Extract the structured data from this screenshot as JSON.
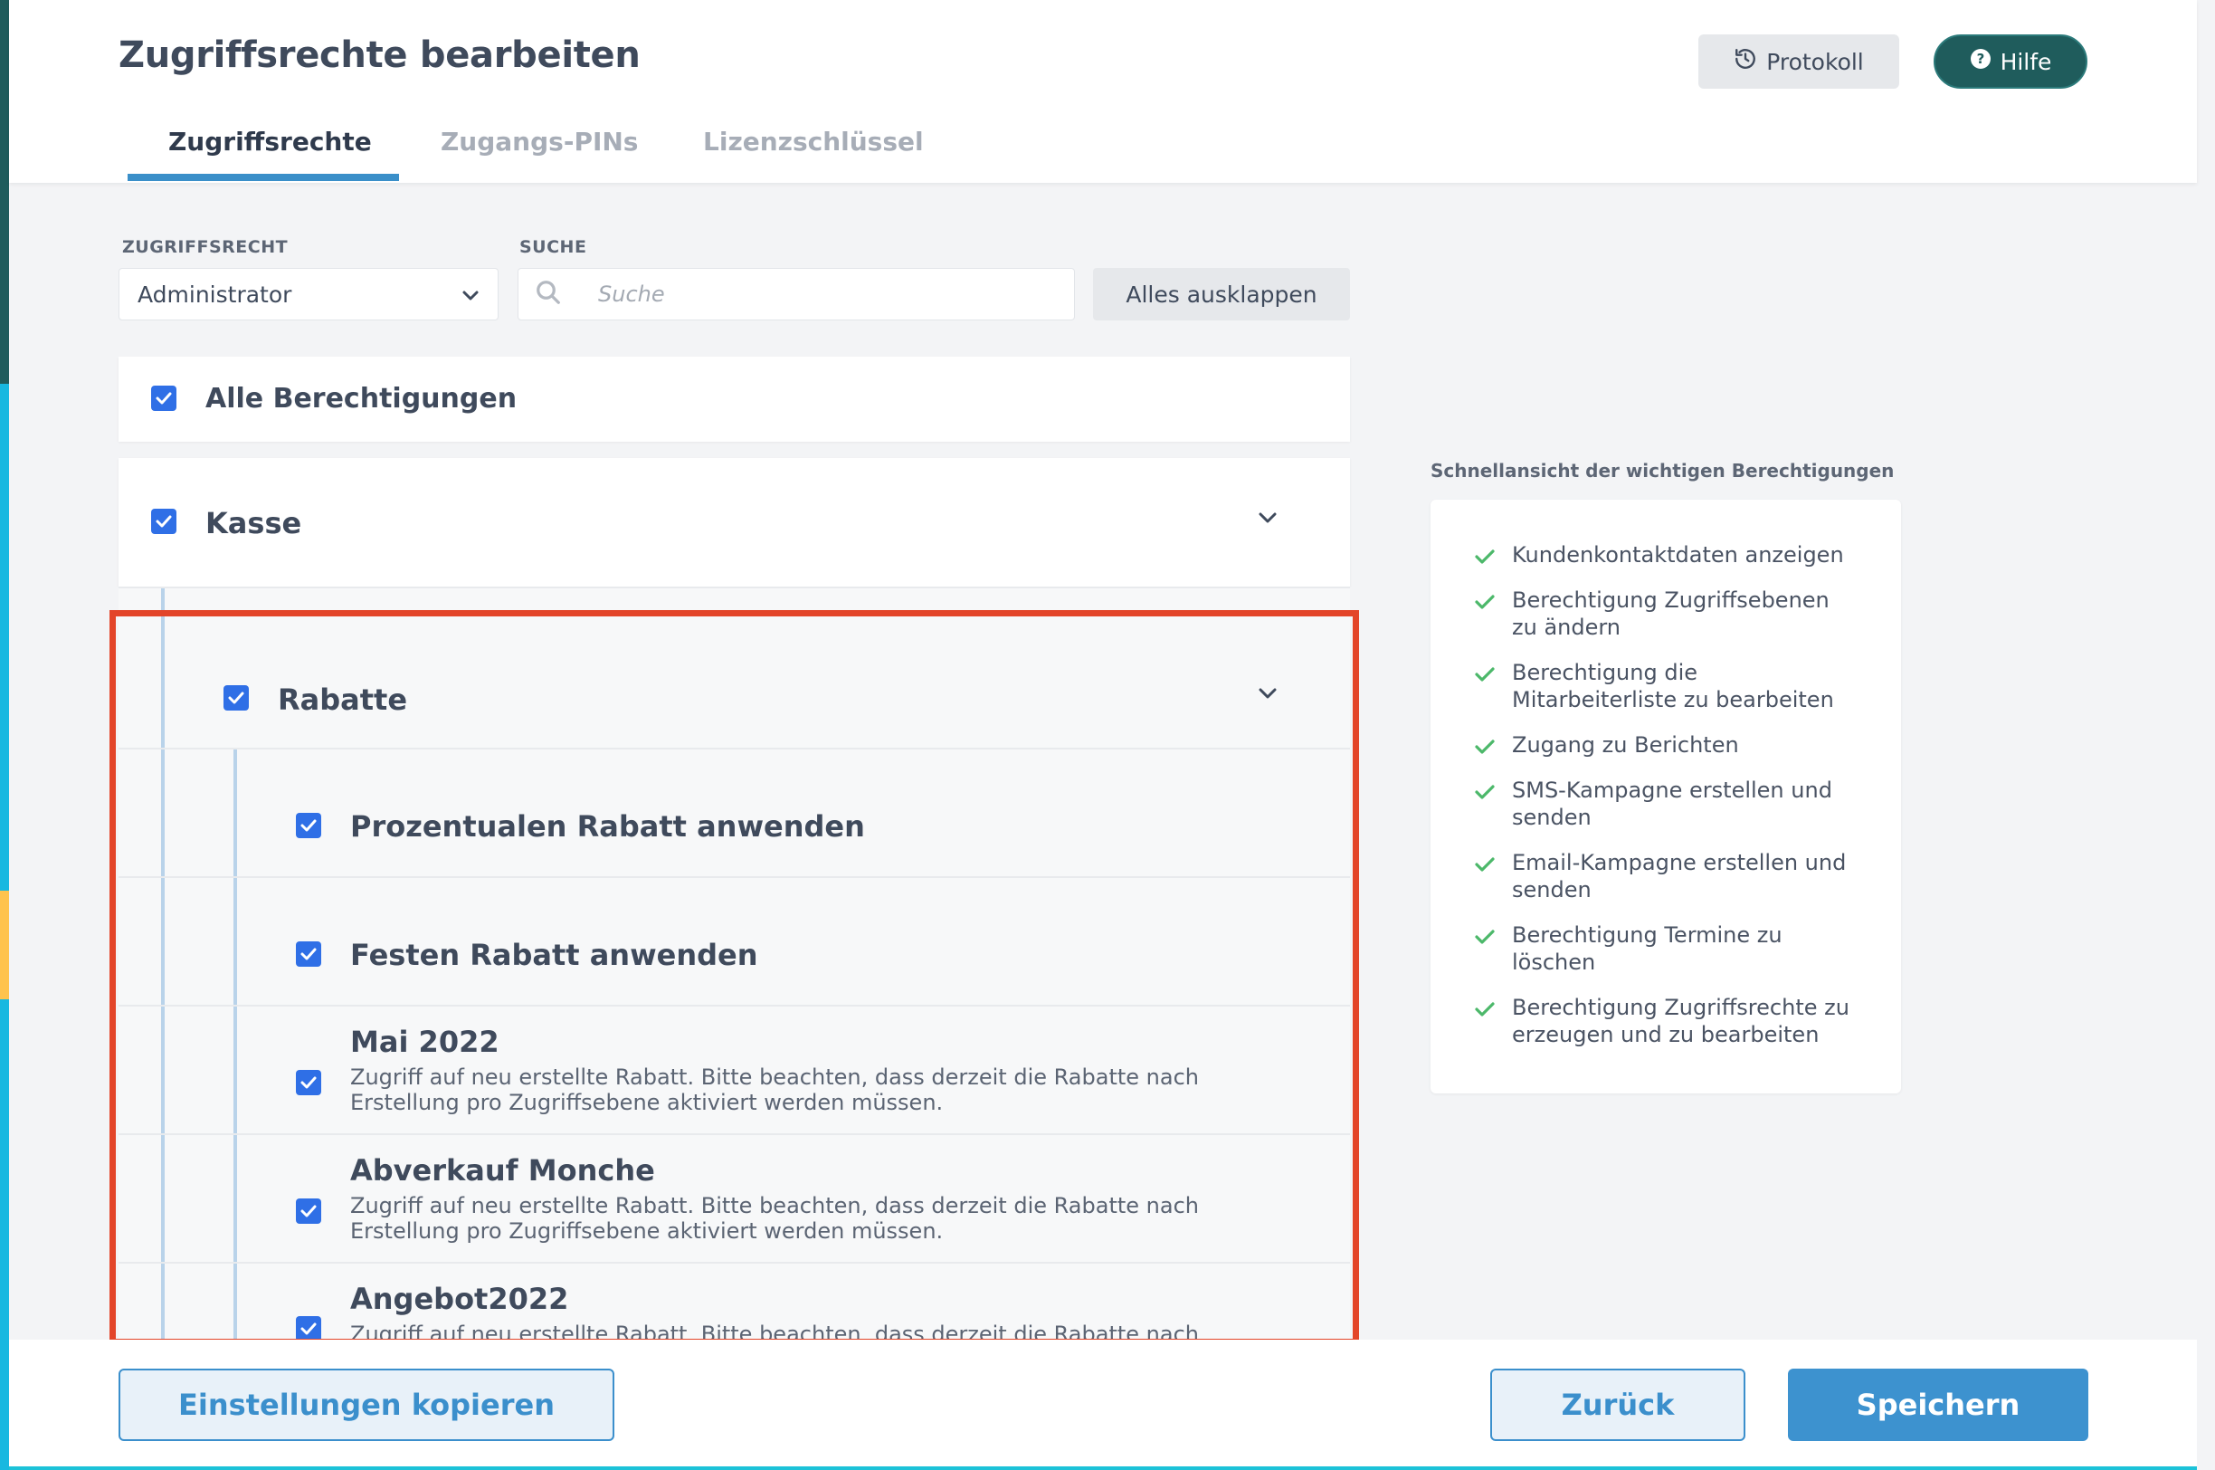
{
  "page": {
    "title": "Zugriffsrechte bearbeiten"
  },
  "header": {
    "protokoll_label": "Protokoll",
    "hilfe_label": "Hilfe",
    "tabs": [
      {
        "label": "Zugriffsrechte",
        "active": true
      },
      {
        "label": "Zugangs-PINs",
        "active": false
      },
      {
        "label": "Lizenzschlüssel",
        "active": false
      }
    ]
  },
  "filters": {
    "role_label": "ZUGRIFFSRECHT",
    "role_value": "Administrator",
    "search_label": "SUCHE",
    "search_placeholder": "Suche",
    "expand_label": "Alles ausklappen"
  },
  "permissions": {
    "all": {
      "label": "Alle Berechtigungen",
      "checked": true
    },
    "kasse": {
      "label": "Kasse",
      "checked": true
    },
    "rabatte": {
      "label": "Rabatte",
      "checked": true
    },
    "items": [
      {
        "label": "Prozentualen Rabatt anwenden",
        "checked": true
      },
      {
        "label": "Festen Rabatt anwenden",
        "checked": true
      },
      {
        "label": "Mai 2022",
        "checked": true,
        "desc_1": "Zugriff auf neu erstellte Rabatt. Bitte beachten, dass derzeit die Rabatte nach",
        "desc_2": "Erstellung pro Zugriffsebene aktiviert werden müssen."
      },
      {
        "label": "Abverkauf Monche",
        "checked": true,
        "desc_1": "Zugriff auf neu erstellte Rabatt. Bitte beachten, dass derzeit die Rabatte nach",
        "desc_2": "Erstellung pro Zugriffsebene aktiviert werden müssen."
      },
      {
        "label": "Angebot2022",
        "checked": true,
        "desc_1": "Zugriff auf neu erstellte Rabatt. Bitte beachten, dass derzeit die Rabatte nach"
      }
    ]
  },
  "quick_view": {
    "title": "Schnellansicht der wichtigen Berechtigungen",
    "items": [
      {
        "line1": "Kundenkontaktdaten anzeigen",
        "line2": ""
      },
      {
        "line1": "Berechtigung Zugriffsebenen",
        "line2": "zu ändern"
      },
      {
        "line1": "Berechtigung die",
        "line2": "Mitarbeiterliste zu bearbeiten"
      },
      {
        "line1": "Zugang zu Berichten",
        "line2": ""
      },
      {
        "line1": "SMS-Kampagne erstellen und",
        "line2": "senden"
      },
      {
        "line1": "Email-Kampagne erstellen und",
        "line2": "senden"
      },
      {
        "line1": "Berechtigung Termine zu",
        "line2": "löschen"
      },
      {
        "line1": "Berechtigung Zugriffsrechte zu",
        "line2": "erzeugen und zu bearbeiten"
      }
    ]
  },
  "footer": {
    "copy_label": "Einstellungen kopieren",
    "back_label": "Zurück",
    "save_label": "Speichern"
  },
  "colors": {
    "accent": "#3d92cf",
    "checkbox": "#2f6fe6",
    "highlight": "#e34529",
    "hilfe_bg": "#1f5c5c",
    "check_green": "#4cb86a"
  },
  "icons": {
    "protokoll": "history-icon",
    "hilfe": "help-circle-icon",
    "select": "chevron-down-icon",
    "search": "search-icon",
    "quick_item": "check-icon"
  }
}
